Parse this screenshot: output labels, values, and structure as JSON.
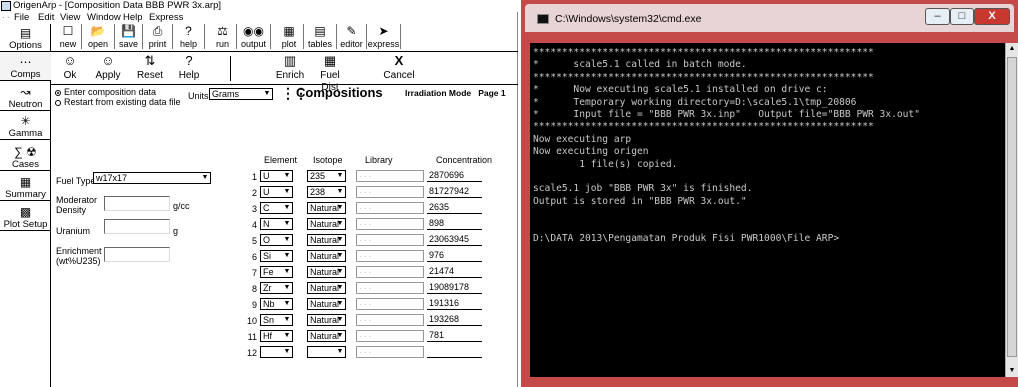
{
  "origen": {
    "title": "OrigenArp - [Composition Data    BBB PWR 3x.arp]",
    "menu": [
      "File",
      "Edit",
      "View",
      "Window",
      "Help",
      "Express"
    ],
    "sidebar": [
      "Options",
      "Comps",
      "Neutron",
      "Gamma",
      "Cases",
      "Summary",
      "Plot Setup"
    ],
    "toolbar1": [
      "new",
      "open",
      "save",
      "print",
      "help",
      "run",
      "output",
      "plot",
      "tables",
      "editor",
      "express"
    ],
    "toolbar2": {
      "ok": "Ok",
      "apply": "Apply",
      "reset": "Reset",
      "help": "Help",
      "enrich": "Enrich",
      "fuel_dist": "Fuel Dist",
      "cancel": "Cancel"
    },
    "form": {
      "radio1": "Enter composition data",
      "radio2": "Restart from existing data file",
      "units_label": "Units",
      "units_value": "Grams",
      "compositions_title": "Compositions",
      "irradiation_label": "Irradiation Mode   Page 1",
      "fuel_type_label": "Fuel Type",
      "fuel_type_value": "w17x17",
      "moderator_label": "Moderator Density",
      "moderator_unit": "g/cc",
      "uranium_label": "Uranium",
      "uranium_unit": "g",
      "enrichment_label": "Enrichment (wt%U235)"
    },
    "table": {
      "headers": [
        "Element",
        "Isotope",
        "Library",
        "Concentration"
      ],
      "rows": [
        {
          "n": "1",
          "element": "U",
          "isotope": "235",
          "conc": "2870696"
        },
        {
          "n": "2",
          "element": "U",
          "isotope": "238",
          "conc": "81727942"
        },
        {
          "n": "3",
          "element": "C",
          "isotope": "Natural",
          "conc": "2635"
        },
        {
          "n": "4",
          "element": "N",
          "isotope": "Natural",
          "conc": "898"
        },
        {
          "n": "5",
          "element": "O",
          "isotope": "Natural",
          "conc": "23063945"
        },
        {
          "n": "6",
          "element": "Si",
          "isotope": "Natural",
          "conc": "976"
        },
        {
          "n": "7",
          "element": "Fe",
          "isotope": "Natural",
          "conc": "21474"
        },
        {
          "n": "8",
          "element": "Zr",
          "isotope": "Natural",
          "conc": "19089178"
        },
        {
          "n": "9",
          "element": "Nb",
          "isotope": "Natural",
          "conc": "191316"
        },
        {
          "n": "10",
          "element": "Sn",
          "isotope": "Natural",
          "conc": "193268"
        },
        {
          "n": "11",
          "element": "Hf",
          "isotope": "Natural",
          "conc": "781"
        },
        {
          "n": "12",
          "element": "",
          "isotope": "",
          "conc": ""
        }
      ]
    }
  },
  "cmd": {
    "title": "C:\\Windows\\system32\\cmd.exe",
    "lines": [
      "***********************************************************",
      "*      scale5.1 called in batch mode.",
      "***********************************************************",
      "*      Now executing scale5.1 installed on drive c:",
      "*      Temporary working directory=D:\\scale5.1\\tmp_20806",
      "*      Input file = \"BBB PWR 3x.inp\"   Output file=\"BBB PWR 3x.out\"",
      "***********************************************************",
      "Now executing arp",
      "Now executing origen",
      "        1 file(s) copied.",
      "",
      "scale5.1 job \"BBB PWR 3x\" is finished.",
      "Output is stored in \"BBB PWR 3x.out.\"",
      "",
      "",
      "D:\\DATA 2013\\Pengamatan Produk Fisi PWR1000\\File ARP>"
    ]
  }
}
